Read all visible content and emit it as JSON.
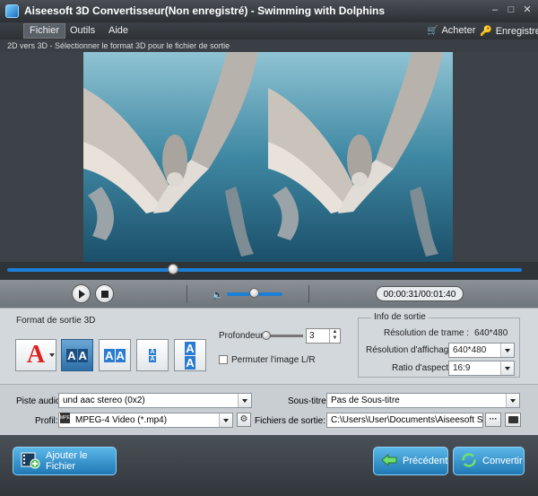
{
  "window": {
    "title": "Aiseesoft 3D Convertisseur(Non enregistré) - Swimming with Dolphins",
    "controls": [
      "minimize",
      "maximize",
      "close"
    ]
  },
  "menu": {
    "items": [
      {
        "label": "Fichier",
        "active": true
      },
      {
        "label": "Outils"
      },
      {
        "label": "Aide"
      }
    ],
    "buy_label": "Acheter",
    "register_label": "Enregistrer",
    "buy_icon": "cart-icon",
    "register_icon": "key-icon"
  },
  "subheader": {
    "text": "2D vers 3D - Sélectionner le format 3D pour le fichier de sortie"
  },
  "playback": {
    "time": "00:00:31/00:01:40",
    "seek_fraction": 0.31,
    "volume_fraction": 0.5,
    "accent_color": "#1c7fd6"
  },
  "format3d": {
    "label": "Format de sortie 3D",
    "depth_label": "Profondeur:",
    "depth_value": "3",
    "swap_label": "Permuter l'image L/R",
    "swap_checked": false,
    "selected_format": "side-by-side"
  },
  "output_info": {
    "title": "Info de sortie",
    "frame_res_label": "Résolution de trame :",
    "frame_res_value": "640*480",
    "display_res_label": "Résolution d'affichage :",
    "display_res_value": "640*480",
    "aspect_label": "Ratio d'aspect:",
    "aspect_value": "16:9"
  },
  "output": {
    "audio_label": "Piste audio:",
    "audio_value": "und aac stereo (0x2)",
    "subtitle_label": "Sous-titre:",
    "subtitle_value": "Pas de Sous-titre",
    "profile_label": "Profil:",
    "profile_value": "MPEG-4 Video (*.mp4)",
    "profile_icon_text": "MPEG",
    "output_files_label": "Fichiers de sortie:",
    "output_path": "C:\\Users\\User\\Documents\\Aiseesoft Studio\\Vid"
  },
  "footer": {
    "add_file": "Ajouter le Fichier",
    "previous": "Précédent",
    "convert": "Convertir"
  }
}
